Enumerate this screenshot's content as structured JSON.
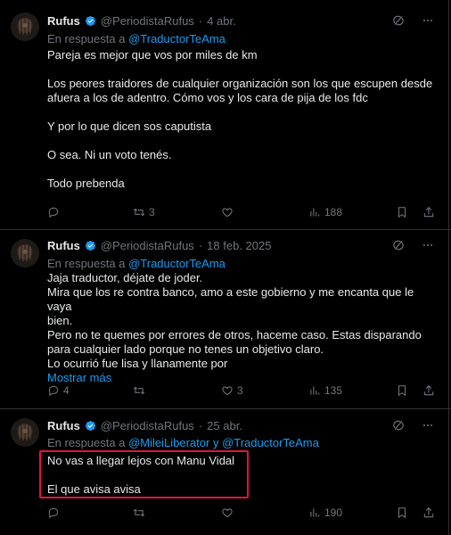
{
  "tweets": [
    {
      "name": "Rufus",
      "handle": "@PeriodistaRufus",
      "sep": "·",
      "date": "4 abr.",
      "reply_prefix": "En respuesta a",
      "reply_to": "@TraductorTeAma",
      "lines": [
        "Pareja es mejor que vos por miles de km",
        "",
        "Los peores traidores de cualquier organización son los que escupen desde",
        "afuera a los de adentro. Cómo vos y los cara de pija de los fdc",
        "",
        "Y por lo que dicen sos caputista",
        "",
        "O sea. Ni un voto tenés.",
        "",
        "Todo prebenda"
      ],
      "stats": {
        "replies": "",
        "retweets": "3",
        "likes": "",
        "views": "188"
      }
    },
    {
      "name": "Rufus",
      "handle": "@PeriodistaRufus",
      "sep": "·",
      "date": "18 feb. 2025",
      "reply_prefix": "En respuesta a",
      "reply_to": "@TraductorTeAma",
      "lines": [
        "Jaja traductor, déjate de joder.",
        "Mira que los re contra banco, amo a este gobierno y me encanta que le vaya",
        "bien.",
        "Pero no te quemes por errores de otros, haceme caso. Estas disparando",
        "para cualquier lado porque no tenes un objetivo claro.",
        "Lo ocurrió fue lisa y llanamente por"
      ],
      "show_more": "Mostrar más",
      "stats": {
        "replies": "4",
        "retweets": "",
        "likes": "3",
        "views": "135"
      }
    },
    {
      "name": "Rufus",
      "handle": "@PeriodistaRufus",
      "sep": "·",
      "date": "25 abr.",
      "reply_prefix": "En respuesta a",
      "reply_to": "@MileiLiberator",
      "reply_and": "y",
      "reply_to2": "@TraductorTeAma",
      "lines": [
        "No vas a llegar lejos con Manu Vidal",
        "",
        "El que avisa avisa"
      ],
      "stats": {
        "replies": "",
        "retweets": "",
        "likes": "",
        "views": "190"
      }
    }
  ],
  "icons": {
    "verified": "verified-badge-icon",
    "grok": "grok-icon",
    "more": "more-icon",
    "reply": "reply-icon",
    "retweet": "retweet-icon",
    "like": "like-icon",
    "views": "views-icon",
    "bookmark": "bookmark-icon",
    "share": "share-icon"
  },
  "colors": {
    "background": "#000000",
    "text": "#e7e9ea",
    "muted": "#71767b",
    "link": "#1d9bf0",
    "highlight": "#e0153c"
  }
}
